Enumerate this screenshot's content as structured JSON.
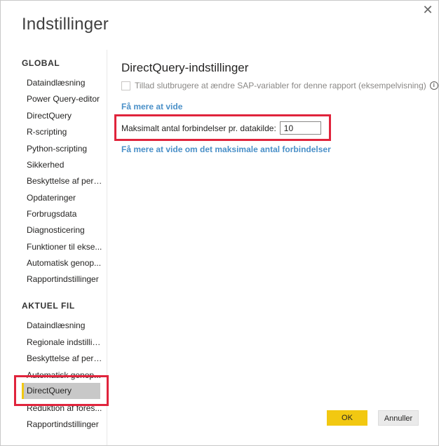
{
  "dialog": {
    "title": "Indstillinger"
  },
  "sidebar": {
    "global_header": "GLOBAL",
    "global_items": [
      "Dataindlæsning",
      "Power Query-editor",
      "DirectQuery",
      "R-scripting",
      "Python-scripting",
      "Sikkerhed",
      "Beskyttelse af pers...",
      "Opdateringer",
      "Forbrugsdata",
      "Diagnosticering",
      "Funktioner til ekse...",
      "Automatisk genop...",
      "Rapportindstillinger"
    ],
    "current_header": "AKTUEL FIL",
    "current_items": [
      "Dataindlæsning",
      "Regionale indstillin...",
      "Beskyttelse af pers...",
      "Automatisk genop...",
      "DirectQuery",
      "Reduktion af fores...",
      "Rapportindstillinger"
    ],
    "active_item": "DirectQuery"
  },
  "main": {
    "title": "DirectQuery-indstillinger",
    "checkbox_label": "Tillad slutbrugere at ændre SAP-variabler for denne rapport (eksempelvisning)",
    "info_glyph": "i",
    "learn_more": "Få mere at vide",
    "max_conn_label": "Maksimalt antal forbindelser pr. datakilde:",
    "max_conn_value": "10",
    "learn_more_max": "Få mere at vide om det maksimale antal forbindelser"
  },
  "buttons": {
    "ok": "OK",
    "cancel": "Annuller"
  },
  "colors": {
    "accent_yellow": "#f2c811",
    "highlight_red": "#e0243c",
    "link_blue": "#4a90c8",
    "active_bg": "#c8c8c8"
  },
  "icons": {
    "close": "close-icon",
    "info": "info-icon"
  }
}
